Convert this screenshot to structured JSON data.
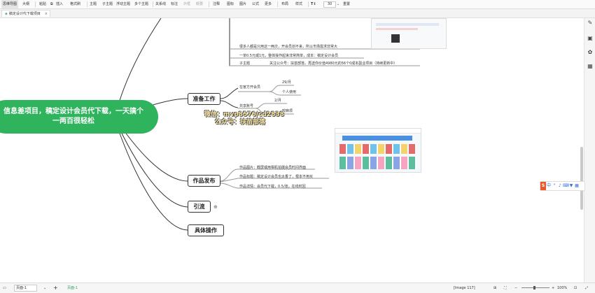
{
  "toolbar": {
    "items": [
      "思维导图",
      "大纲",
      "粘贴",
      "格式刷",
      "主题",
      "子主题",
      "浮动主题",
      "多个主题",
      "关系线",
      "标注",
      "外框",
      "概要",
      "注释",
      "图标",
      "图片",
      "公式",
      "更多",
      "布局",
      "样式",
      "重置"
    ],
    "font_size": "30",
    "paste_sub": "插入"
  },
  "tab": {
    "title": "稿定设计代下载项目",
    "icon": "mindmap-icon"
  },
  "root": {
    "title_line1": "信息差项目，稿定设计会员代下载，一天搞个",
    "title_line2": "一两百很轻松"
  },
  "branches": {
    "prepare": "准备工作",
    "publish": "作品发布",
    "traffic": "引流",
    "operate": "具体操作"
  },
  "top_leaves": [
    "很多人都是只用这一两次，开会员划不来，所以市场需求非常大",
    "一单0.5元或1元，整体操作起来非常简单，成本：稿定设计会员",
    "子主题",
    "关注公众号：扶苗部落，再送你价值4980元的56个0成本副业项目（持续更新中）"
  ],
  "prepare_leaves": {
    "official_vip": "在官方开会员",
    "price_month": "29/月",
    "personal_use": "个人使用",
    "shared_account": "共享账号",
    "price_shared": "2/月",
    "shared_note": "较麻烦"
  },
  "publish_leaves": [
    "作品图片：截屏或用相机拍摄会员时间界面",
    "作品标题：稿定设计会员也太香了，根本不用买",
    "作品详情：会员代下载，0.5/张，在线时回"
  ],
  "watermark": {
    "line1": "微信：mvp8576/cd2838",
    "line2": "公众号：扶苗部落"
  },
  "statusbar": {
    "page_label": "页面-1",
    "page_tab": "页面-1",
    "add": "+",
    "image_info": "[Image 117]",
    "zoom": "100%"
  },
  "floatbar_label": "中"
}
